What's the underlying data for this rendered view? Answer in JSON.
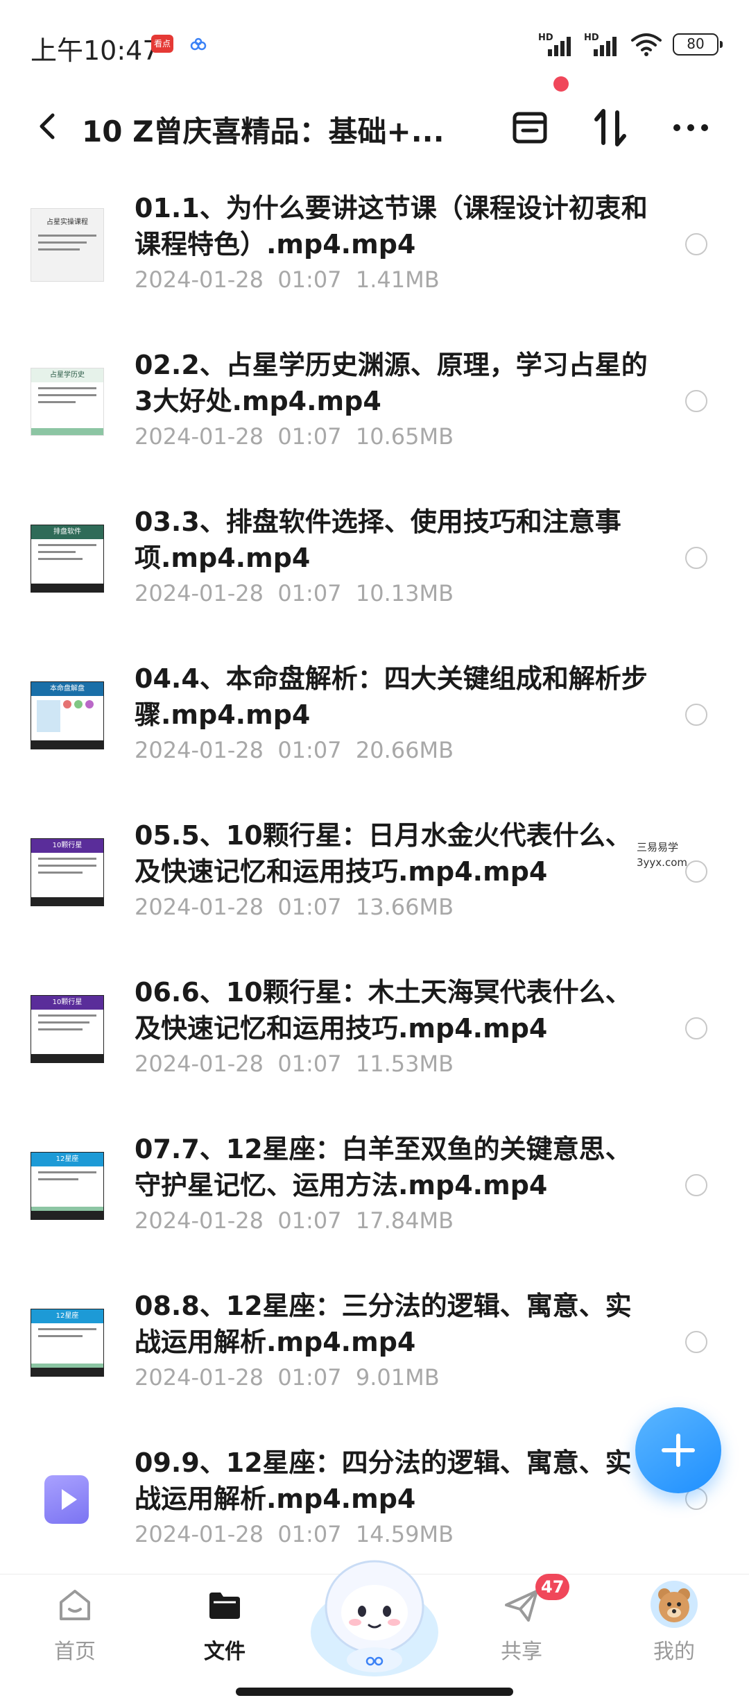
{
  "status_bar": {
    "time": "上午10:47",
    "app_badge": "看点",
    "signal1": "HD",
    "signal2": "HD",
    "battery": "80"
  },
  "header": {
    "title": "10 Z曾庆喜精品：基础+...",
    "icons": [
      "back-arrow-icon",
      "transfer-icon",
      "sort-icon",
      "more-icon"
    ]
  },
  "files": [
    {
      "name": "01.1、为什么要讲这节课（课程设计初衷和课程特色）.mp4.mp4",
      "meta": "2024-01-28  01:07  1.41MB",
      "thumb_title": "占星实操课程",
      "thumb_color": "#f2f2f2"
    },
    {
      "name": "02.2、占星学历史渊源、原理，学习占星的3大好处.mp4.mp4",
      "meta": "2024-01-28  01:07  10.65MB",
      "thumb_title": "占星学历史",
      "thumb_color": "#e6f2ea"
    },
    {
      "name": "03.3、排盘软件选择、使用技巧和注意事项.mp4.mp4",
      "meta": "2024-01-28  01:07  10.13MB",
      "thumb_title": "排盘软件",
      "thumb_color": "#2f6b58"
    },
    {
      "name": "04.4、本命盘解析：四大关键组成和解析步骤.mp4.mp4",
      "meta": "2024-01-28  01:07  20.66MB",
      "thumb_title": "本命盘解盘",
      "thumb_color": "#1a6fa8"
    },
    {
      "name": "05.5、10颗行星：日月水金火代表什么、及快速记忆和运用技巧.mp4.mp4",
      "meta": "2024-01-28  01:07  13.66MB",
      "thumb_title": "10颗行星",
      "thumb_color": "#5a2d9a"
    },
    {
      "name": "06.6、10颗行星：木土天海冥代表什么、及快速记忆和运用技巧.mp4.mp4",
      "meta": "2024-01-28  01:07  11.53MB",
      "thumb_title": "10颗行星",
      "thumb_color": "#5a2d9a"
    },
    {
      "name": "07.7、12星座：白羊至双鱼的关键意思、守护星记忆、运用方法.mp4.mp4",
      "meta": "2024-01-28  01:07  17.84MB",
      "thumb_title": "12星座",
      "thumb_color": "#1d9ad6"
    },
    {
      "name": "08.8、12星座：三分法的逻辑、寓意、实战运用解析.mp4.mp4",
      "meta": "2024-01-28  01:07  9.01MB",
      "thumb_title": "12星座",
      "thumb_color": "#1d9ad6"
    },
    {
      "name": "09.9、12星座：四分法的逻辑、寓意、实战运用解析.mp4.mp4",
      "meta": "2024-01-28  01:07  14.59MB",
      "thumb_title": "",
      "thumb_color": ""
    }
  ],
  "watermark": {
    "line1": "三易易学",
    "line2": "3yyx.com"
  },
  "bottom_nav": {
    "home": "首页",
    "files": "文件",
    "share": "共享",
    "me": "我的",
    "share_badge": "47"
  },
  "colors": {
    "accent": "#1e8fff",
    "badge": "#f0475a",
    "meta_text": "#a8a8a8"
  }
}
